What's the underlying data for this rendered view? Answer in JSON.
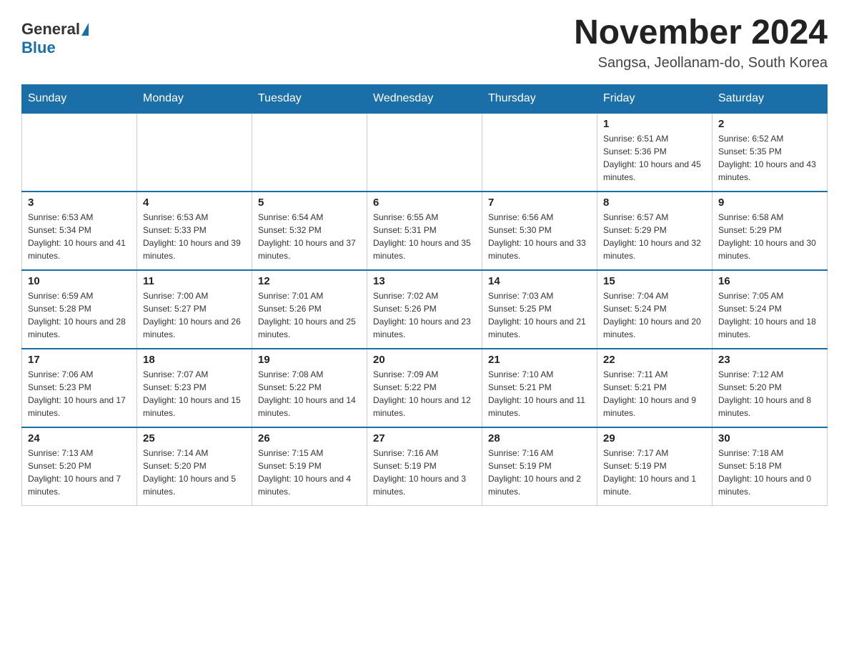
{
  "logo": {
    "general": "General",
    "blue": "Blue"
  },
  "title": "November 2024",
  "location": "Sangsa, Jeollanam-do, South Korea",
  "days_of_week": [
    "Sunday",
    "Monday",
    "Tuesday",
    "Wednesday",
    "Thursday",
    "Friday",
    "Saturday"
  ],
  "weeks": [
    [
      {
        "day": "",
        "info": ""
      },
      {
        "day": "",
        "info": ""
      },
      {
        "day": "",
        "info": ""
      },
      {
        "day": "",
        "info": ""
      },
      {
        "day": "",
        "info": ""
      },
      {
        "day": "1",
        "info": "Sunrise: 6:51 AM\nSunset: 5:36 PM\nDaylight: 10 hours and 45 minutes."
      },
      {
        "day": "2",
        "info": "Sunrise: 6:52 AM\nSunset: 5:35 PM\nDaylight: 10 hours and 43 minutes."
      }
    ],
    [
      {
        "day": "3",
        "info": "Sunrise: 6:53 AM\nSunset: 5:34 PM\nDaylight: 10 hours and 41 minutes."
      },
      {
        "day": "4",
        "info": "Sunrise: 6:53 AM\nSunset: 5:33 PM\nDaylight: 10 hours and 39 minutes."
      },
      {
        "day": "5",
        "info": "Sunrise: 6:54 AM\nSunset: 5:32 PM\nDaylight: 10 hours and 37 minutes."
      },
      {
        "day": "6",
        "info": "Sunrise: 6:55 AM\nSunset: 5:31 PM\nDaylight: 10 hours and 35 minutes."
      },
      {
        "day": "7",
        "info": "Sunrise: 6:56 AM\nSunset: 5:30 PM\nDaylight: 10 hours and 33 minutes."
      },
      {
        "day": "8",
        "info": "Sunrise: 6:57 AM\nSunset: 5:29 PM\nDaylight: 10 hours and 32 minutes."
      },
      {
        "day": "9",
        "info": "Sunrise: 6:58 AM\nSunset: 5:29 PM\nDaylight: 10 hours and 30 minutes."
      }
    ],
    [
      {
        "day": "10",
        "info": "Sunrise: 6:59 AM\nSunset: 5:28 PM\nDaylight: 10 hours and 28 minutes."
      },
      {
        "day": "11",
        "info": "Sunrise: 7:00 AM\nSunset: 5:27 PM\nDaylight: 10 hours and 26 minutes."
      },
      {
        "day": "12",
        "info": "Sunrise: 7:01 AM\nSunset: 5:26 PM\nDaylight: 10 hours and 25 minutes."
      },
      {
        "day": "13",
        "info": "Sunrise: 7:02 AM\nSunset: 5:26 PM\nDaylight: 10 hours and 23 minutes."
      },
      {
        "day": "14",
        "info": "Sunrise: 7:03 AM\nSunset: 5:25 PM\nDaylight: 10 hours and 21 minutes."
      },
      {
        "day": "15",
        "info": "Sunrise: 7:04 AM\nSunset: 5:24 PM\nDaylight: 10 hours and 20 minutes."
      },
      {
        "day": "16",
        "info": "Sunrise: 7:05 AM\nSunset: 5:24 PM\nDaylight: 10 hours and 18 minutes."
      }
    ],
    [
      {
        "day": "17",
        "info": "Sunrise: 7:06 AM\nSunset: 5:23 PM\nDaylight: 10 hours and 17 minutes."
      },
      {
        "day": "18",
        "info": "Sunrise: 7:07 AM\nSunset: 5:23 PM\nDaylight: 10 hours and 15 minutes."
      },
      {
        "day": "19",
        "info": "Sunrise: 7:08 AM\nSunset: 5:22 PM\nDaylight: 10 hours and 14 minutes."
      },
      {
        "day": "20",
        "info": "Sunrise: 7:09 AM\nSunset: 5:22 PM\nDaylight: 10 hours and 12 minutes."
      },
      {
        "day": "21",
        "info": "Sunrise: 7:10 AM\nSunset: 5:21 PM\nDaylight: 10 hours and 11 minutes."
      },
      {
        "day": "22",
        "info": "Sunrise: 7:11 AM\nSunset: 5:21 PM\nDaylight: 10 hours and 9 minutes."
      },
      {
        "day": "23",
        "info": "Sunrise: 7:12 AM\nSunset: 5:20 PM\nDaylight: 10 hours and 8 minutes."
      }
    ],
    [
      {
        "day": "24",
        "info": "Sunrise: 7:13 AM\nSunset: 5:20 PM\nDaylight: 10 hours and 7 minutes."
      },
      {
        "day": "25",
        "info": "Sunrise: 7:14 AM\nSunset: 5:20 PM\nDaylight: 10 hours and 5 minutes."
      },
      {
        "day": "26",
        "info": "Sunrise: 7:15 AM\nSunset: 5:19 PM\nDaylight: 10 hours and 4 minutes."
      },
      {
        "day": "27",
        "info": "Sunrise: 7:16 AM\nSunset: 5:19 PM\nDaylight: 10 hours and 3 minutes."
      },
      {
        "day": "28",
        "info": "Sunrise: 7:16 AM\nSunset: 5:19 PM\nDaylight: 10 hours and 2 minutes."
      },
      {
        "day": "29",
        "info": "Sunrise: 7:17 AM\nSunset: 5:19 PM\nDaylight: 10 hours and 1 minute."
      },
      {
        "day": "30",
        "info": "Sunrise: 7:18 AM\nSunset: 5:18 PM\nDaylight: 10 hours and 0 minutes."
      }
    ]
  ]
}
